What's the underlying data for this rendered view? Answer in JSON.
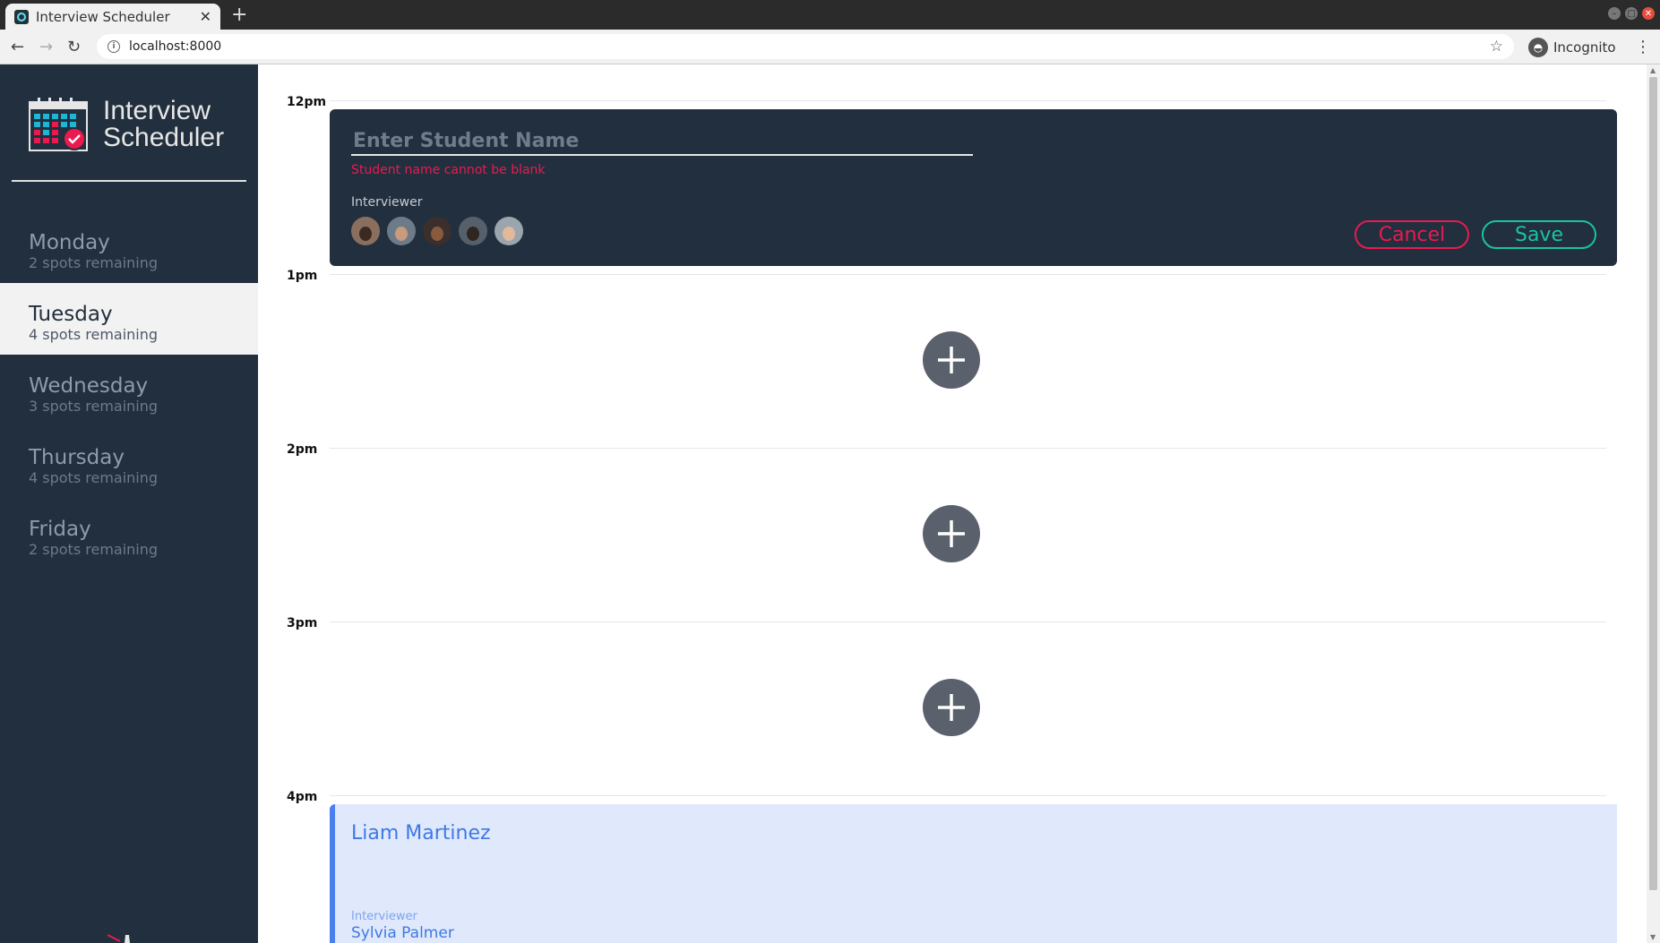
{
  "browser": {
    "tab_title": "Interview Scheduler",
    "tab_close": "✕",
    "new_tab": "+",
    "url": "localhost:8000",
    "incognito_label": "Incognito"
  },
  "sidebar": {
    "logo_line1": "Interview",
    "logo_line2": "Scheduler",
    "days": [
      {
        "name": "Monday",
        "spots": "2 spots remaining"
      },
      {
        "name": "Tuesday",
        "spots": "4 spots remaining",
        "selected": true
      },
      {
        "name": "Wednesday",
        "spots": "3 spots remaining"
      },
      {
        "name": "Thursday",
        "spots": "4 spots remaining"
      },
      {
        "name": "Friday",
        "spots": "2 spots remaining"
      }
    ]
  },
  "schedule": {
    "times": [
      "12pm",
      "1pm",
      "2pm",
      "3pm",
      "4pm"
    ],
    "form": {
      "placeholder": "Enter Student Name",
      "validation": "Student name cannot be blank",
      "interviewer_label": "Interviewer",
      "cancel_label": "Cancel",
      "save_label": "Save"
    },
    "booked": {
      "student": "Liam Martinez",
      "interviewer_label": "Interviewer",
      "interviewer": "Sylvia Palmer"
    }
  },
  "colors": {
    "sidebar_bg": "#222f3e",
    "danger": "#ea1a4f",
    "success": "#19c3a4",
    "booked_accent": "#4b7ff0"
  }
}
